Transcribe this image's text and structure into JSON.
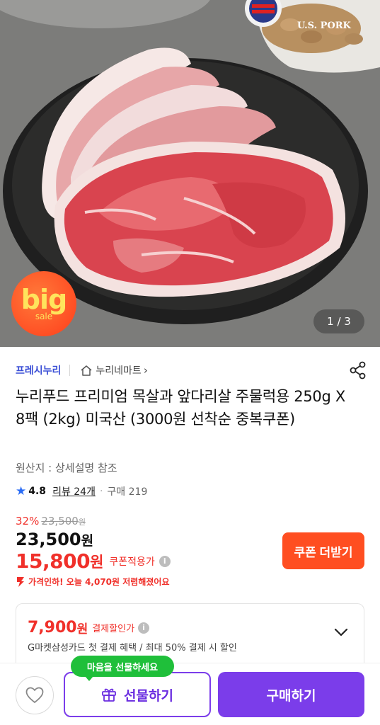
{
  "hero": {
    "badge_big": "big",
    "badge_sale": "sale",
    "brand_logo_text": "U.S. PORK",
    "pager": "1 / 3"
  },
  "seller": {
    "name": "프레시누리",
    "mart_label": "누리네마트",
    "mart_chevron": "›"
  },
  "product": {
    "title": "누리푸드 프리미엄 목살과 앞다리살 주물럭용 250g X 8팩 (2kg) 미국산 (3000원 선착순 중복쿠폰)",
    "origin": "원산지 : 상세설명 참조",
    "rating": "4.8",
    "reviews": "리뷰 24개",
    "sales": "구매 219"
  },
  "pricing": {
    "discount_pct": "32%",
    "original_price": "23,500",
    "original_unit": "원",
    "sale_price": "23,500",
    "sale_unit": "원",
    "coupon_price": "15,800",
    "coupon_unit": "원",
    "coupon_label": "쿠폰적용가",
    "coupon_button": "쿠폰 더받기",
    "price_drop": "가격인하! 오늘 4,070원 저렴해졌어요"
  },
  "payment": {
    "price": "7,900",
    "unit": "원",
    "label": "결제할인가",
    "desc": "G마켓삼성카드 첫 결제 혜택 / 최대 50% 결제 시 할인"
  },
  "bottom": {
    "gift_tooltip": "마음을 선물하세요",
    "gift_button": "선물하기",
    "buy_button": "구매하기"
  },
  "colors": {
    "accent_purple": "#7b3dea",
    "price_red": "#f0302a",
    "coupon_orange": "#ff4e21",
    "seller_blue": "#3b4fd6",
    "tooltip_green": "#1fbf3a"
  },
  "icons": [
    "home-icon",
    "share-icon",
    "star-icon",
    "info-icon",
    "arrow-down-icon",
    "chevron-down-icon",
    "heart-icon",
    "gift-icon"
  ]
}
